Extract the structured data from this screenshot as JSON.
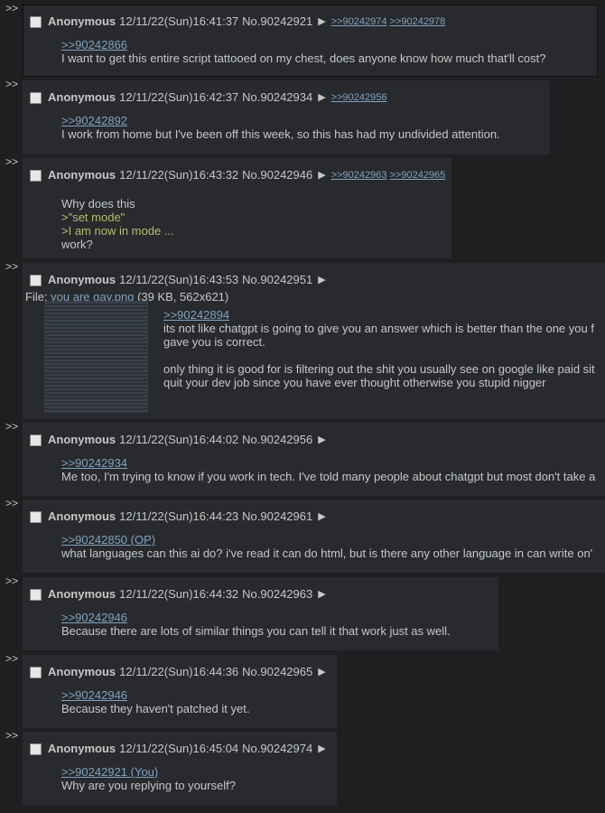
{
  "arrows": ">>",
  "posts": [
    {
      "name": "Anonymous",
      "date": "12/11/22(Sun)16:41:37",
      "no": "No.90242921",
      "backlinks": [
        ">>90242974",
        ">>90242978"
      ],
      "lines": [
        {
          "type": "quote",
          "text": ">>90242866"
        },
        {
          "type": "text",
          "text": "I want to get this entire script tattooed on my chest, does anyone know how much that'll cost?"
        }
      ]
    },
    {
      "name": "Anonymous",
      "date": "12/11/22(Sun)16:42:37",
      "no": "No.90242934",
      "backlinks": [
        ">>90242956"
      ],
      "lines": [
        {
          "type": "quote",
          "text": ">>90242892"
        },
        {
          "type": "text",
          "text": "I work from home but I've been off this week, so this has had my undivided attention."
        }
      ]
    },
    {
      "name": "Anonymous",
      "date": "12/11/22(Sun)16:43:32",
      "no": "No.90242946",
      "backlinks": [
        ">>90242963",
        ">>90242965"
      ],
      "lines": [
        {
          "type": "text",
          "text": "Why does this"
        },
        {
          "type": "green",
          "text": ">\"set mode\""
        },
        {
          "type": "green",
          "text": ">I am now in mode ..."
        },
        {
          "type": "text",
          "text": "work?"
        }
      ]
    },
    {
      "name": "Anonymous",
      "date": "12/11/22(Sun)16:43:53",
      "no": "No.90242951",
      "backlinks": [],
      "file": {
        "label": "File: ",
        "name": "you are gay.png",
        "meta": " (39 KB, 562x621)"
      },
      "lines": [
        {
          "type": "quote",
          "text": ">>90242894"
        },
        {
          "type": "text",
          "text": "its not like chatgpt is going to give you an answer which is better than the one you f"
        },
        {
          "type": "text",
          "text": "gave you is correct."
        },
        {
          "type": "spacer",
          "text": ""
        },
        {
          "type": "text",
          "text": "only thing it is good for is filtering out the shit you usually see on google like paid sit"
        },
        {
          "type": "text",
          "text": "quit your dev job since you have ever thought otherwise you stupid nigger"
        }
      ]
    },
    {
      "name": "Anonymous",
      "date": "12/11/22(Sun)16:44:02",
      "no": "No.90242956",
      "backlinks": [],
      "lines": [
        {
          "type": "quote",
          "text": ">>90242934"
        },
        {
          "type": "text",
          "text": "Me too, I'm trying to know if you work in tech. I've told many people about chatgpt but most don't take a"
        }
      ]
    },
    {
      "name": "Anonymous",
      "date": "12/11/22(Sun)16:44:23",
      "no": "No.90242961",
      "backlinks": [],
      "lines": [
        {
          "type": "quote",
          "text": ">>90242850 (OP)"
        },
        {
          "type": "text",
          "text": "what languages can this ai do? i've read it can do html, but is there any other language in can write on'"
        }
      ]
    },
    {
      "name": "Anonymous",
      "date": "12/11/22(Sun)16:44:32",
      "no": "No.90242963",
      "backlinks": [],
      "lines": [
        {
          "type": "quote",
          "text": ">>90242946"
        },
        {
          "type": "text",
          "text": "Because there are lots of similar things you can tell it that work just as well."
        }
      ]
    },
    {
      "name": "Anonymous",
      "date": "12/11/22(Sun)16:44:36",
      "no": "No.90242965",
      "backlinks": [],
      "lines": [
        {
          "type": "quote",
          "text": ">>90242946"
        },
        {
          "type": "text",
          "text": "Because they haven't patched it yet."
        }
      ]
    },
    {
      "name": "Anonymous",
      "date": "12/11/22(Sun)16:45:04",
      "no": "No.90242974",
      "backlinks": [],
      "lines": [
        {
          "type": "quote",
          "text": ">>90242921 (You)"
        },
        {
          "type": "text",
          "text": "Why are you replying to yourself?"
        }
      ]
    }
  ]
}
